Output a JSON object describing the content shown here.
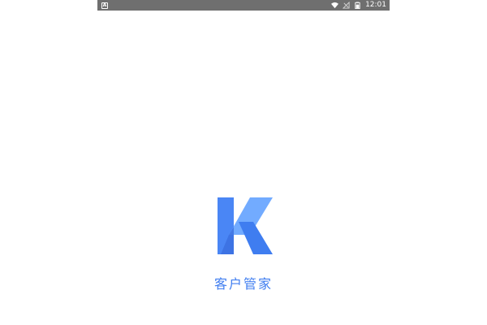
{
  "status_bar": {
    "notification_icon": "a-notification-icon",
    "wifi_icon": "wifi-icon",
    "signal_icon": "no-signal-icon",
    "battery_icon": "battery-icon",
    "time": "12:01",
    "background_color": "#6f6f6f"
  },
  "splash": {
    "logo_icon": "k-logo-icon",
    "app_name": "客户管家",
    "brand_color": "#3f7df0",
    "brand_color_light": "#6ea8ff"
  }
}
